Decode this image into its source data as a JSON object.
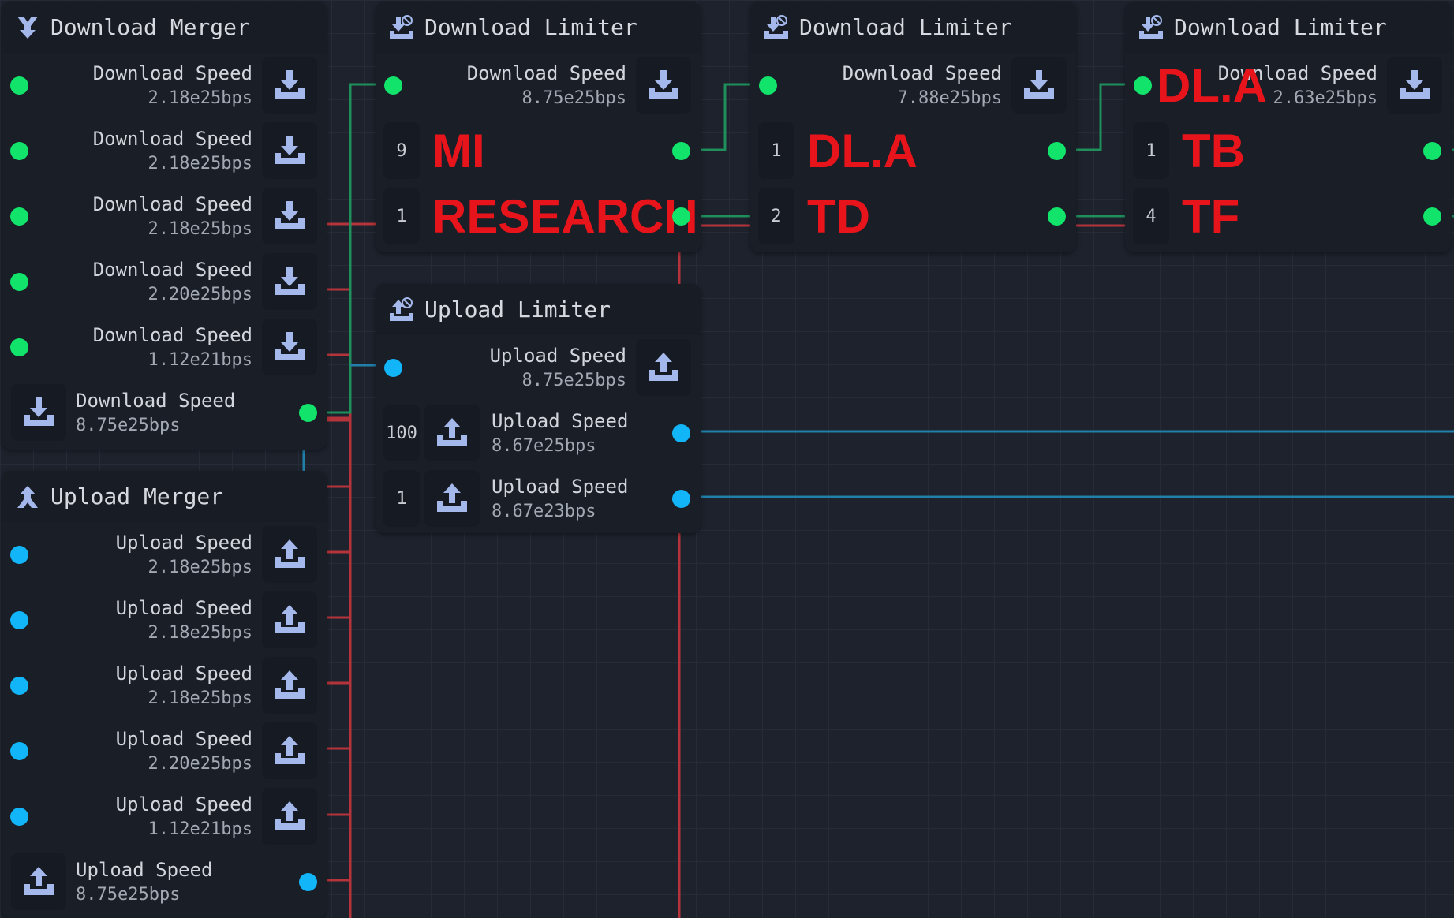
{
  "colors": {
    "download_port": "#11e36b",
    "upload_port": "#12b5f7",
    "icon": "#a4b8ec",
    "annotation": "#e8141c",
    "wire_red": "#b5343b",
    "wire_green": "#1f8f5c",
    "wire_blue": "#2180aa"
  },
  "panels": [
    {
      "id": "download-merger",
      "title": "Download Merger",
      "icon": "merge-down-icon",
      "port": "download",
      "rows": [
        {
          "kind": "input",
          "label": "Download Speed",
          "value": "2.18e25bps",
          "icon": "download-icon"
        },
        {
          "kind": "input",
          "label": "Download Speed",
          "value": "2.18e25bps",
          "icon": "download-icon"
        },
        {
          "kind": "input",
          "label": "Download Speed",
          "value": "2.18e25bps",
          "icon": "download-icon"
        },
        {
          "kind": "input",
          "label": "Download Speed",
          "value": "2.20e25bps",
          "icon": "download-icon"
        },
        {
          "kind": "input",
          "label": "Download Speed",
          "value": "1.12e21bps",
          "icon": "download-icon"
        },
        {
          "kind": "output",
          "label": "Download Speed",
          "value": "8.75e25bps",
          "icon": "download-icon"
        }
      ]
    },
    {
      "id": "upload-merger",
      "title": "Upload Merger",
      "icon": "merge-up-icon",
      "port": "upload",
      "rows": [
        {
          "kind": "input",
          "label": "Upload Speed",
          "value": "2.18e25bps",
          "icon": "upload-icon"
        },
        {
          "kind": "input",
          "label": "Upload Speed",
          "value": "2.18e25bps",
          "icon": "upload-icon"
        },
        {
          "kind": "input",
          "label": "Upload Speed",
          "value": "2.18e25bps",
          "icon": "upload-icon"
        },
        {
          "kind": "input",
          "label": "Upload Speed",
          "value": "2.20e25bps",
          "icon": "upload-icon"
        },
        {
          "kind": "input",
          "label": "Upload Speed",
          "value": "1.12e21bps",
          "icon": "upload-icon"
        },
        {
          "kind": "output",
          "label": "Upload Speed",
          "value": "8.75e25bps",
          "icon": "upload-icon"
        }
      ]
    },
    {
      "id": "download-limiter-1",
      "title": "Download Limiter",
      "icon": "download-limiter-icon",
      "port": "download",
      "rows": [
        {
          "kind": "input",
          "label": "Download Speed",
          "value": "8.75e25bps",
          "icon": "download-icon"
        },
        {
          "kind": "limit",
          "count": "9",
          "annotation": "MI"
        },
        {
          "kind": "limit",
          "count": "1",
          "annotation": "RESEARCH"
        }
      ]
    },
    {
      "id": "upload-limiter",
      "title": "Upload Limiter",
      "icon": "upload-limiter-icon",
      "port": "upload",
      "rows": [
        {
          "kind": "input",
          "label": "Upload Speed",
          "value": "8.75e25bps",
          "icon": "upload-icon"
        },
        {
          "kind": "limit-icon",
          "count": "100",
          "label": "Upload Speed",
          "value": "8.67e25bps",
          "icon": "upload-icon"
        },
        {
          "kind": "limit-icon",
          "count": "1",
          "label": "Upload Speed",
          "value": "8.67e23bps",
          "icon": "upload-icon"
        }
      ]
    },
    {
      "id": "download-limiter-2",
      "title": "Download Limiter",
      "icon": "download-limiter-icon",
      "port": "download",
      "rows": [
        {
          "kind": "input",
          "label": "Download Speed",
          "value": "7.88e25bps",
          "icon": "download-icon"
        },
        {
          "kind": "limit",
          "count": "1",
          "annotation": "DL.A"
        },
        {
          "kind": "limit",
          "count": "2",
          "annotation": "TD"
        }
      ]
    },
    {
      "id": "download-limiter-3",
      "title": "Download Limiter",
      "icon": "download-limiter-icon",
      "port": "download",
      "rows": [
        {
          "kind": "input",
          "label": "Download Speed",
          "value": "2.63e25bps",
          "icon": "download-icon",
          "annotation": "DL.A"
        },
        {
          "kind": "limit",
          "count": "1",
          "annotation": "TB"
        },
        {
          "kind": "limit",
          "count": "4",
          "annotation": "TF"
        }
      ]
    }
  ]
}
